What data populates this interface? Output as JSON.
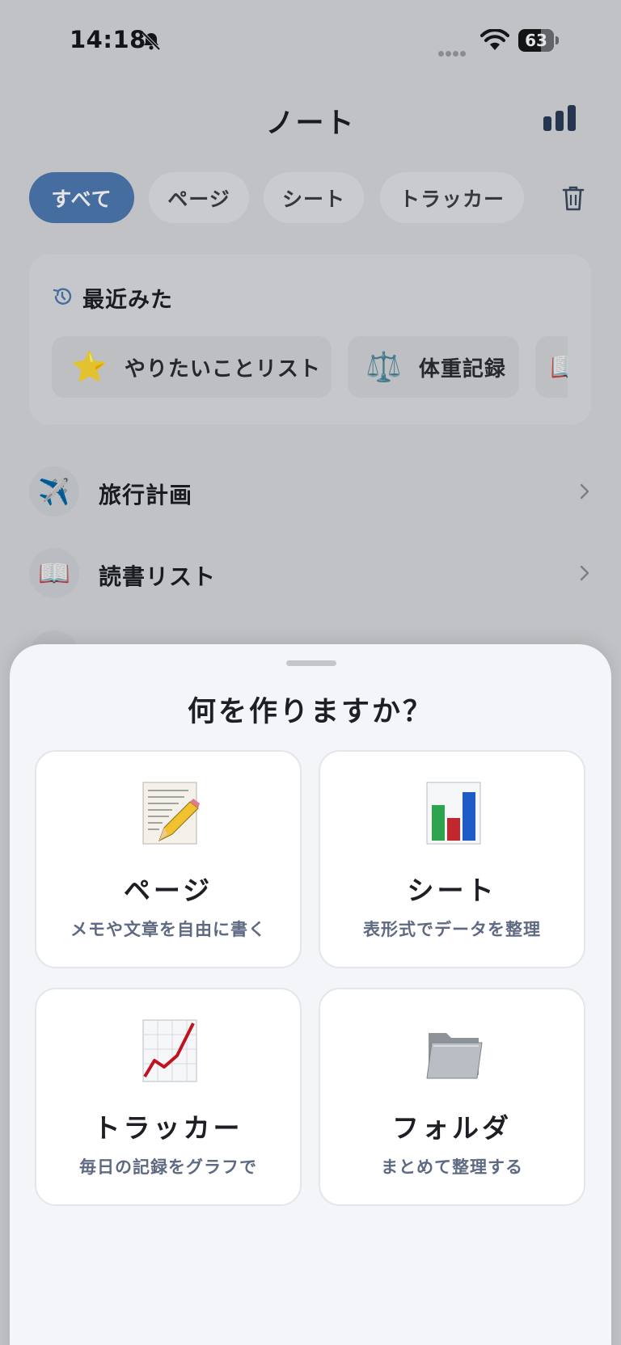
{
  "status_bar": {
    "time": "14:18",
    "battery": "63",
    "icons": [
      "bell-slash-icon",
      "signal-icon",
      "wifi-icon",
      "battery-icon"
    ]
  },
  "header": {
    "title": "ノート",
    "stats_icon": "bar-chart-icon"
  },
  "filters": {
    "tabs": [
      {
        "label": "すべて",
        "active": true
      },
      {
        "label": "ページ",
        "active": false
      },
      {
        "label": "シート",
        "active": false
      },
      {
        "label": "トラッカー",
        "active": false
      }
    ],
    "trash_icon": "trash-icon"
  },
  "recent": {
    "title": "最近みた",
    "items": [
      {
        "emoji": "⭐",
        "label": "やりたいことリスト"
      },
      {
        "emoji": "⚖️",
        "label": "体重記録"
      },
      {
        "emoji": "📖",
        "label": ""
      }
    ]
  },
  "notes": [
    {
      "emoji": "✈️",
      "label": "旅行計画"
    },
    {
      "emoji": "📖",
      "label": "読書リスト"
    }
  ],
  "sheet": {
    "title": "何を作りますか？",
    "options": [
      {
        "label": "ページ",
        "desc": "メモや文章を自由に書く",
        "icon": "page-pencil-icon"
      },
      {
        "label": "シート",
        "desc": "表形式でデータを整理",
        "icon": "bar-chart-sheet-icon"
      },
      {
        "label": "トラッカー",
        "desc": "毎日の記録をグラフで",
        "icon": "line-graph-icon"
      },
      {
        "label": "フォルダ",
        "desc": "まとめて整理する",
        "icon": "folder-icon"
      }
    ]
  },
  "colors": {
    "accent": "#4e7ab3",
    "desc_text": "#5e6a82",
    "sheet_bg": "#f3f5f8"
  }
}
